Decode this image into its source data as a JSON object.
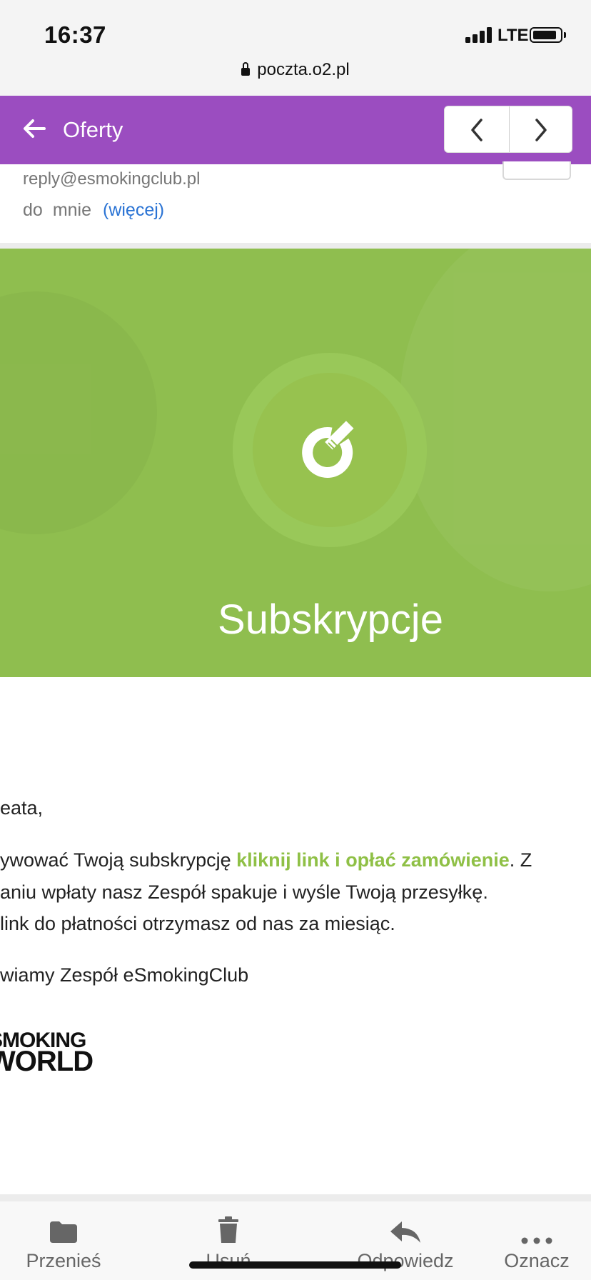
{
  "status": {
    "time": "16:37",
    "network": "LTE"
  },
  "browser": {
    "url": "poczta.o2.pl"
  },
  "header": {
    "title": "Oferty"
  },
  "email": {
    "sender": "reply@esmokingclub.pl",
    "to_prefix": "do",
    "to_value": "mnie",
    "more_label": "(więcej)"
  },
  "hero": {
    "title": "Subskrypcje"
  },
  "body": {
    "greeting": "eata,",
    "line1_before": "ywować Twoją subskrypcję ",
    "line1_link": "kliknij link i opłać zamówienie",
    "line1_after": ". Z",
    "line2": "aniu wpłaty nasz Zespół spakuje i wyśle Twoją przesyłkę.",
    "line3": " link do płatności otrzymasz od nas za miesiąc.",
    "signature": "wiamy Zespół eSmokingClub",
    "logo_line1": "SMOKING",
    "logo_line2": "WORLD"
  },
  "toolbar": {
    "move": "Przenieś",
    "delete": "Usuń",
    "reply": "Odpowiedz",
    "mark": "Oznacz"
  },
  "colors": {
    "header": "#9b4dc0",
    "hero": "#8fbe4f",
    "link": "#8fc046",
    "more_link": "#2a73d4"
  }
}
